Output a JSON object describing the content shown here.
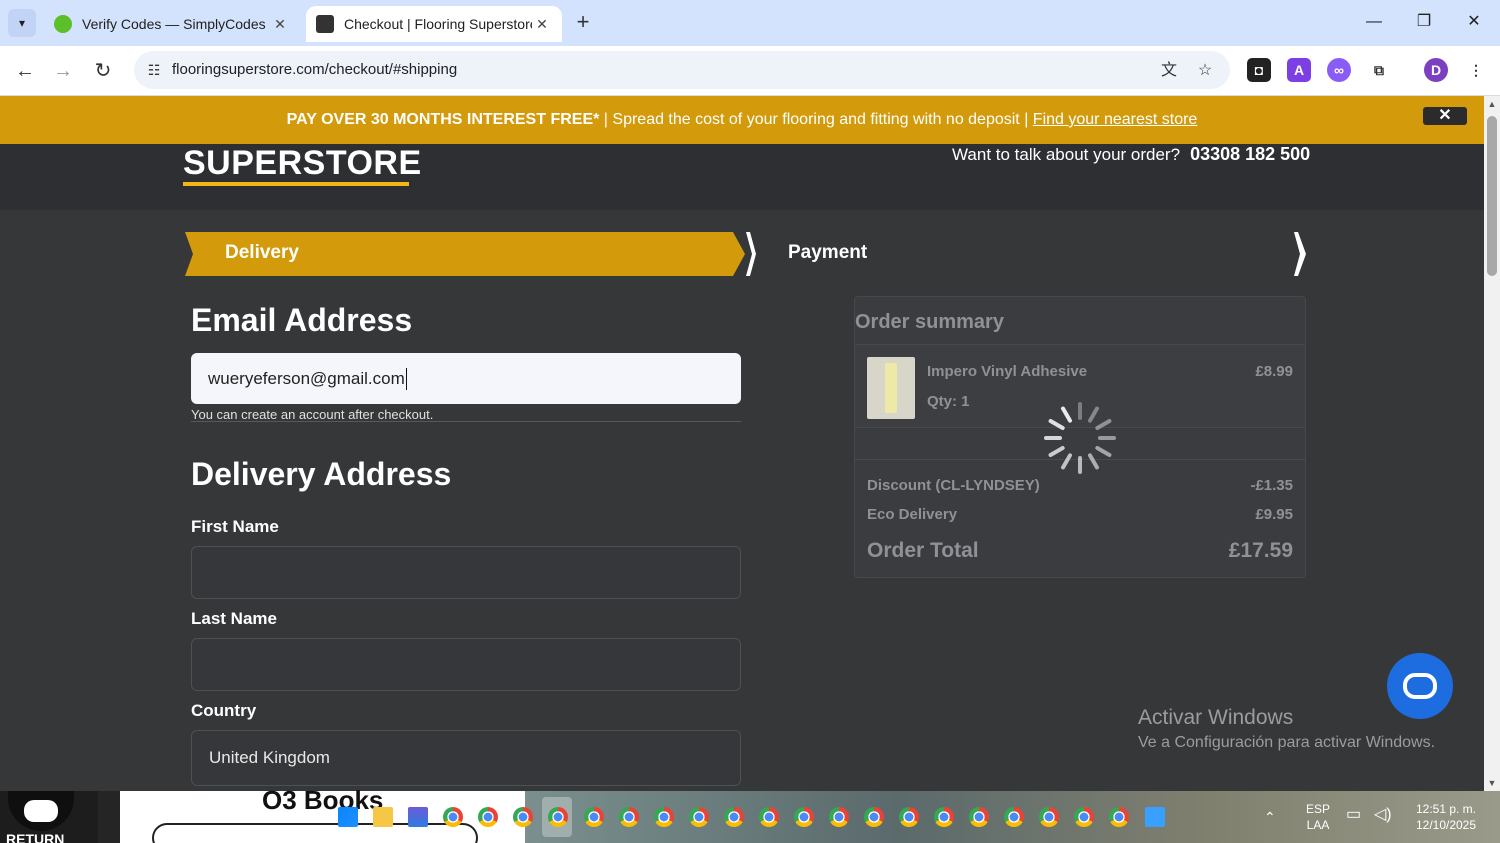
{
  "browser": {
    "tabs": [
      {
        "title": "Verify Codes — SimplyCodes",
        "favicon_color": "#5cbf2a",
        "active": false
      },
      {
        "title": "Checkout | Flooring Superstore",
        "favicon_color": "#333333",
        "active": true
      }
    ],
    "url": "flooringsuperstore.com/checkout/#shipping"
  },
  "promo": {
    "bold": "PAY OVER 30 MONTHS INTEREST FREE*",
    "sep": " | ",
    "text": "Spread the cost of your flooring and fitting with no deposit",
    "link": "Find your nearest store",
    "close": "✕"
  },
  "header": {
    "logo": "SUPERSTORE",
    "talk_label": "Want to talk about your order?",
    "phone": "03308 182 500"
  },
  "stepper": {
    "delivery": "Delivery",
    "payment": "Payment"
  },
  "form": {
    "email_heading": "Email Address",
    "email_value": "wueryeferson@gmail.com",
    "email_hint": "You can create an account after checkout.",
    "delivery_heading": "Delivery Address",
    "first_name_label": "First Name",
    "first_name_value": "",
    "last_name_label": "Last Name",
    "last_name_value": "",
    "country_label": "Country",
    "country_value": "United Kingdom"
  },
  "summary": {
    "title": "Order summary",
    "item": {
      "name": "Impero Vinyl Adhesive",
      "qty": "Qty: 1",
      "price": "£8.99"
    },
    "rows": [
      {
        "label": "Discount (CL-LYNDSEY)",
        "value": "-£1.35"
      },
      {
        "label": "Eco Delivery",
        "value": "£9.95"
      }
    ],
    "total_label": "Order Total",
    "total_value": "£17.59"
  },
  "watermark": {
    "line1": "Activar Windows",
    "line2": "Ve a Configuración para activar Windows."
  },
  "taskbar": {
    "return_label": "RETURN",
    "books_label": "O3 Books",
    "lang_top": "ESP",
    "lang_bottom": "LAA",
    "time": "12:51 p. m.",
    "date": "12/10/2025"
  }
}
